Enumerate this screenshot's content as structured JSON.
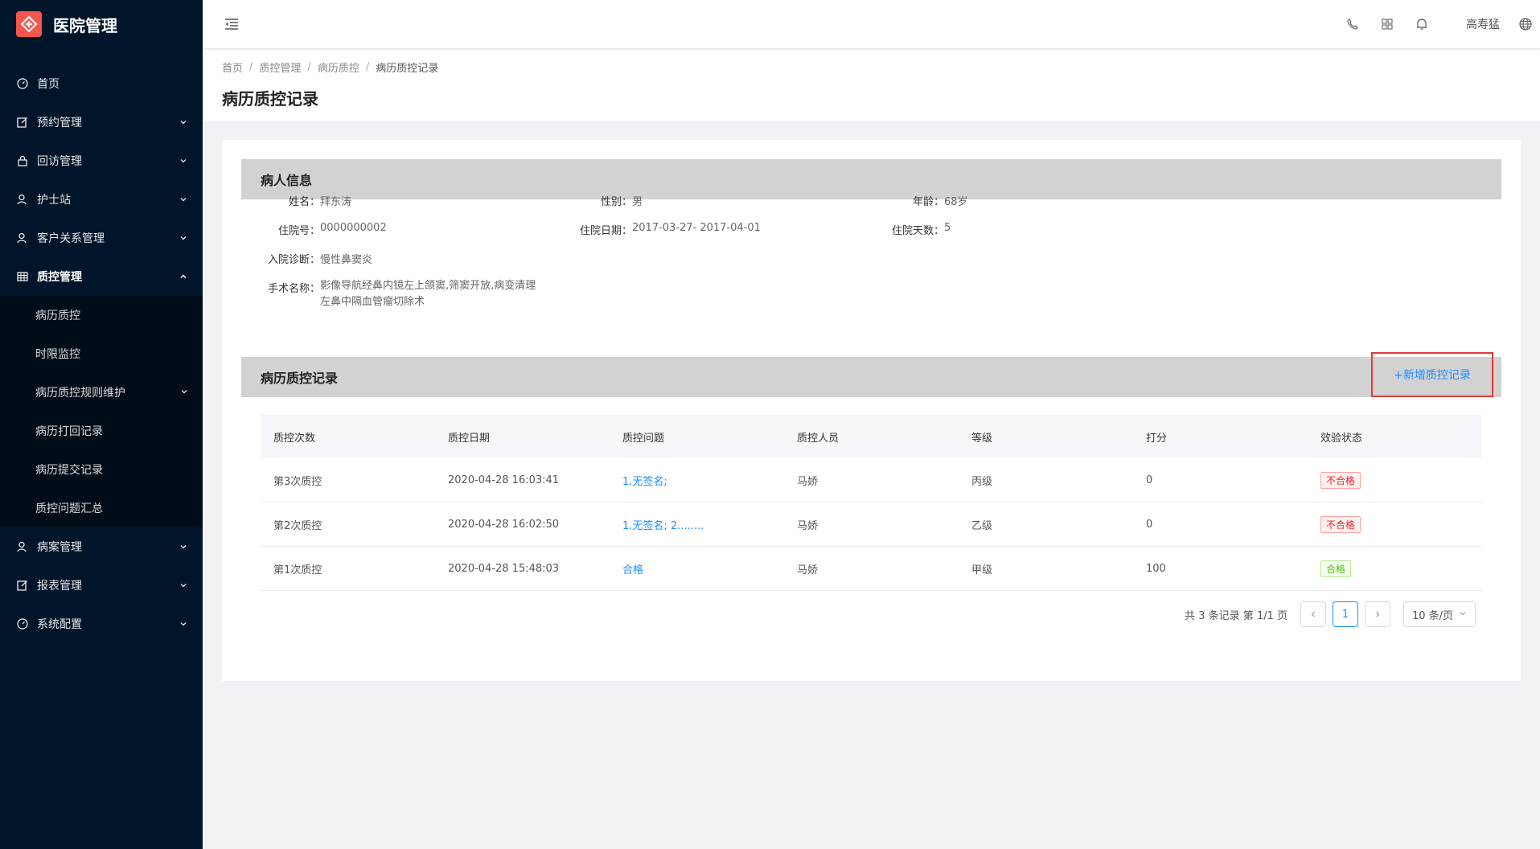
{
  "app": {
    "title": "医院管理",
    "brand_color": "#f5574c"
  },
  "sidebar": {
    "items": [
      {
        "label": "首页",
        "icon": "dashboard-icon",
        "has_children": false
      },
      {
        "label": "预约管理",
        "icon": "edit-icon",
        "has_children": true
      },
      {
        "label": "回访管理",
        "icon": "lock-icon",
        "has_children": true
      },
      {
        "label": "护士站",
        "icon": "user-icon",
        "has_children": true
      },
      {
        "label": "客户关系管理",
        "icon": "user-icon",
        "has_children": true
      },
      {
        "label": "质控管理",
        "icon": "table-icon",
        "has_children": true,
        "open": true
      }
    ],
    "subitems": [
      {
        "label": "病历质控"
      },
      {
        "label": "时限监控"
      },
      {
        "label": "病历质控规则维护",
        "has_children": true
      },
      {
        "label": "病历打回记录"
      },
      {
        "label": "病历提交记录"
      },
      {
        "label": "质控问题汇总"
      }
    ],
    "items_after": [
      {
        "label": "病案管理",
        "icon": "user-icon",
        "has_children": true
      },
      {
        "label": "报表管理",
        "icon": "edit-icon",
        "has_children": true
      },
      {
        "label": "系统配置",
        "icon": "dashboard-icon",
        "has_children": true
      }
    ]
  },
  "header": {
    "username": "高寿猛"
  },
  "breadcrumb": {
    "items": [
      "首页",
      "质控管理",
      "病历质控"
    ],
    "current": "病历质控记录"
  },
  "page": {
    "title": "病历质控记录"
  },
  "patient": {
    "section_title": "病人信息",
    "name_label": "姓名：",
    "name": "拜东涛",
    "gender_label": "性别：",
    "gender": "男",
    "age_label": "年龄：",
    "age": "68岁",
    "admission_no_label": "住院号：",
    "admission_no": "0000000002",
    "dates_label": "住院日期：",
    "dates": "2017-03-27- 2017-04-01",
    "days_label": "住院天数：",
    "days": "5",
    "diagnosis_label": "入院诊断：",
    "diagnosis": "慢性鼻窦炎",
    "surgery_label": "手术名称：",
    "surgery": "影像导航经鼻内镜左上颌窦,筛窦开放,病变清理左鼻中隔血管瘤切除术"
  },
  "records": {
    "section_title": "病历质控记录",
    "add_label": "+新增质控记录",
    "columns": [
      "质控次数",
      "质控日期",
      "质控问题",
      "质控人员",
      "等级",
      "打分",
      "效验状态"
    ],
    "rows": [
      {
        "count": "第3次质控",
        "date": "2020-04-28 16:03:41",
        "issue": "1.无签名;",
        "person": "马娇",
        "level": "丙级",
        "score": "0",
        "status": "不合格",
        "status_type": "fail"
      },
      {
        "count": "第2次质控",
        "date": "2020-04-28 16:02:50",
        "issue": "1.无签名; 2........",
        "person": "马娇",
        "level": "乙级",
        "score": "0",
        "status": "不合格",
        "status_type": "fail"
      },
      {
        "count": "第1次质控",
        "date": "2020-04-28 15:48:03",
        "issue": "合格",
        "person": "马娇",
        "level": "甲级",
        "score": "100",
        "status": "合格",
        "status_type": "pass"
      }
    ]
  },
  "pagination": {
    "total_text": "共 3 条记录 第 1/1 页",
    "current_page": "1",
    "page_size": "10 条/页"
  }
}
